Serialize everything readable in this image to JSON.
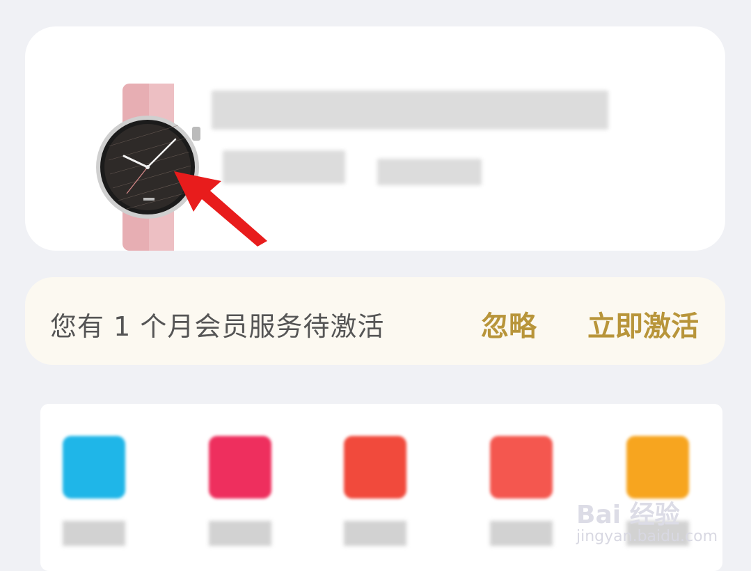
{
  "device": {
    "image": "smartwatch-pink-band",
    "name_obscured": true,
    "status_obscured": true
  },
  "arrow": {
    "color": "#e81c1c",
    "icon": "red-pointer-arrow"
  },
  "banner": {
    "message": "您有 1 个月会员服务待激活",
    "ignore_label": "忽略",
    "activate_label": "立即激活",
    "accent_color": "#b8953a"
  },
  "apps": [
    {
      "icon_color": "#1fb6e8"
    },
    {
      "icon_color": "#ee2f5e"
    },
    {
      "icon_color": "#f14a3c"
    },
    {
      "icon_color": "#f4574f"
    },
    {
      "icon_color": "#f7a51f"
    }
  ],
  "watermark": {
    "main": "Bai 经验",
    "sub": "jingyan.baidu.com"
  }
}
